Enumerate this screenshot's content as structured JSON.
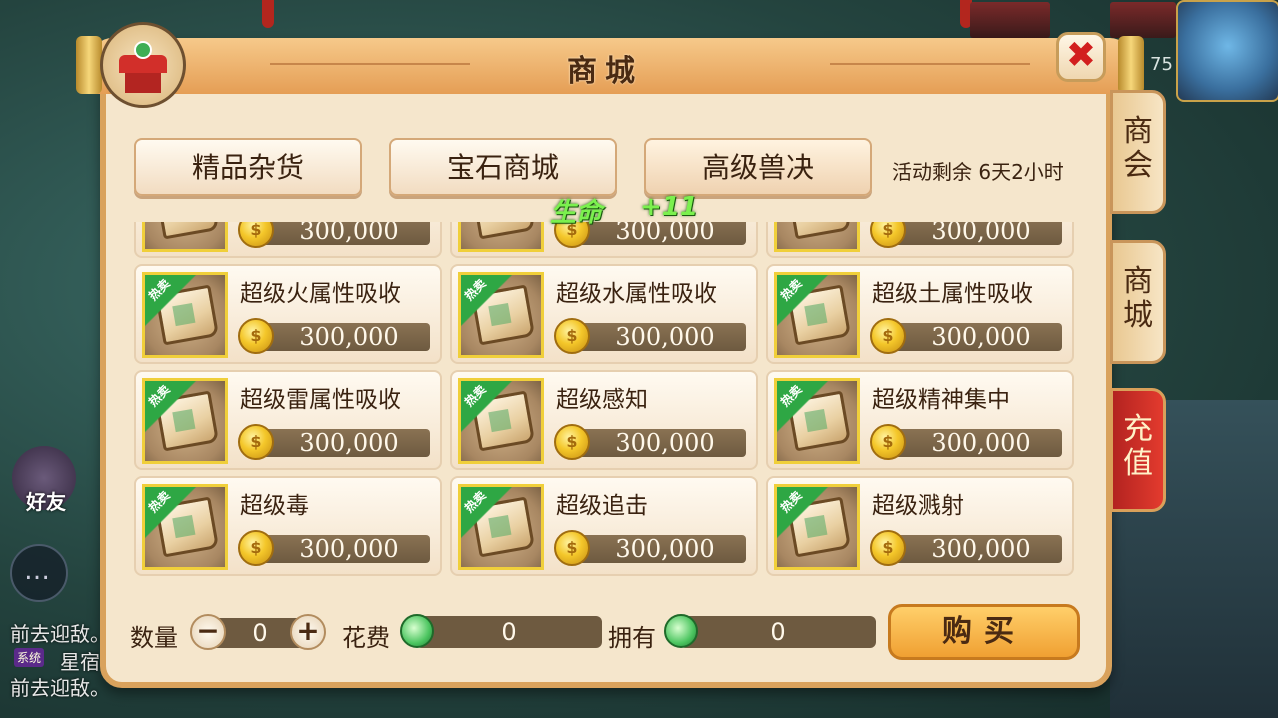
{
  "background": {
    "level": "75",
    "friend_label": "好友",
    "chat_lines": [
      "前去迎敌。",
      "星宿",
      "前去迎敌。"
    ],
    "system_tag": "系统"
  },
  "window": {
    "title": "商城",
    "close_label": "✖"
  },
  "side_tabs": [
    "商会",
    "商城",
    "充值"
  ],
  "category_tabs": [
    "精品杂货",
    "宝石商城",
    "高级兽决"
  ],
  "active_category": "高级兽决",
  "timer": "活动剩余 6天2小时",
  "float_text": {
    "stat": "生命",
    "value": "+11"
  },
  "hot_label": "热卖",
  "coin_glyph": "$",
  "items": [
    {
      "name": "",
      "price": "300,000",
      "hot": false
    },
    {
      "name": "",
      "price": "300,000",
      "hot": false
    },
    {
      "name": "",
      "price": "300,000",
      "hot": false
    },
    {
      "name": "超级火属性吸收",
      "price": "300,000",
      "hot": true
    },
    {
      "name": "超级水属性吸收",
      "price": "300,000",
      "hot": true
    },
    {
      "name": "超级土属性吸收",
      "price": "300,000",
      "hot": true
    },
    {
      "name": "超级雷属性吸收",
      "price": "300,000",
      "hot": true
    },
    {
      "name": "超级感知",
      "price": "300,000",
      "hot": true
    },
    {
      "name": "超级精神集中",
      "price": "300,000",
      "hot": true
    },
    {
      "name": "超级毒",
      "price": "300,000",
      "hot": true
    },
    {
      "name": "超级追击",
      "price": "300,000",
      "hot": true
    },
    {
      "name": "超级溅射",
      "price": "300,000",
      "hot": true
    }
  ],
  "purchase": {
    "quantity_label": "数量",
    "quantity": "0",
    "minus": "−",
    "plus": "+",
    "cost_label": "花费",
    "cost": "0",
    "owned_label": "拥有",
    "owned": "0",
    "buy_label": "购买"
  }
}
